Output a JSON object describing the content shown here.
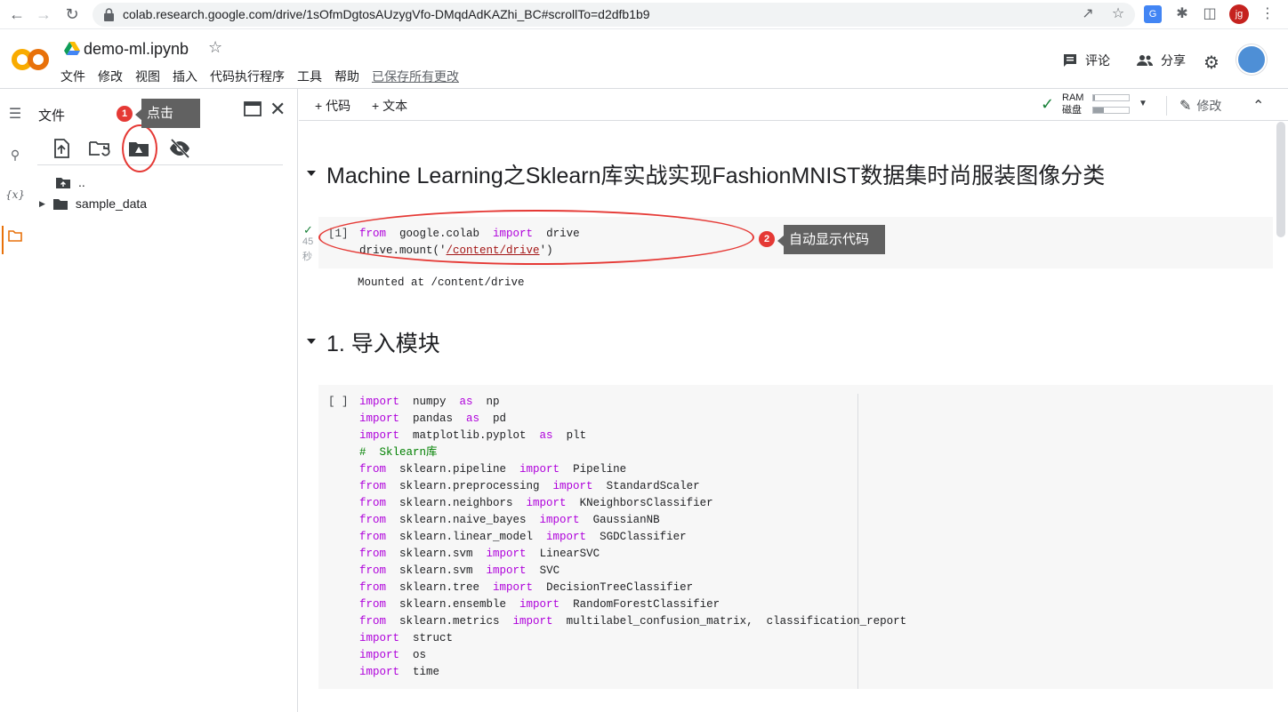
{
  "browser": {
    "url": "colab.research.google.com/drive/1sOfmDgtosAUzygVfo-DMqdAdKAZhi_BC#scrollTo=d2dfb1b9",
    "profile_initials": "jg"
  },
  "header": {
    "notebook_name": "demo-ml.ipynb",
    "menu": [
      "文件",
      "修改",
      "视图",
      "插入",
      "代码执行程序",
      "工具",
      "帮助"
    ],
    "saved_status": "已保存所有更改",
    "comment_label": "评论",
    "share_label": "分享"
  },
  "file_panel": {
    "title": "文件",
    "tree": [
      {
        "label": ".."
      },
      {
        "label": "sample_data"
      }
    ]
  },
  "annotations": {
    "tip1_number": "1",
    "tip1_text": "点击",
    "tip2_number": "2",
    "tip2_text": "自动显示代码"
  },
  "toolbar": {
    "add_code": "+ 代码",
    "add_text": "+ 文本",
    "ram_label": "RAM",
    "disk_label": "磁盘",
    "ram_level": 0.05,
    "disk_level": 0.3,
    "edit_label": "修改"
  },
  "notebook": {
    "heading1": "Machine Learning之Sklearn库实战实现FashionMNIST数据集时尚服装图像分类",
    "cell1": {
      "exec_count": "[1]",
      "exec_time": "45",
      "exec_unit": "秒",
      "output": "Mounted at /content/drive"
    },
    "heading2": "1. 导入模块",
    "cell2": {
      "exec_count": "[ ]"
    }
  },
  "colors": {
    "keyword": "#af00db",
    "comment": "#008000",
    "annotation_red": "#e53935",
    "tooltip_bg": "#616161",
    "colab_orange": "#f9ab00"
  }
}
